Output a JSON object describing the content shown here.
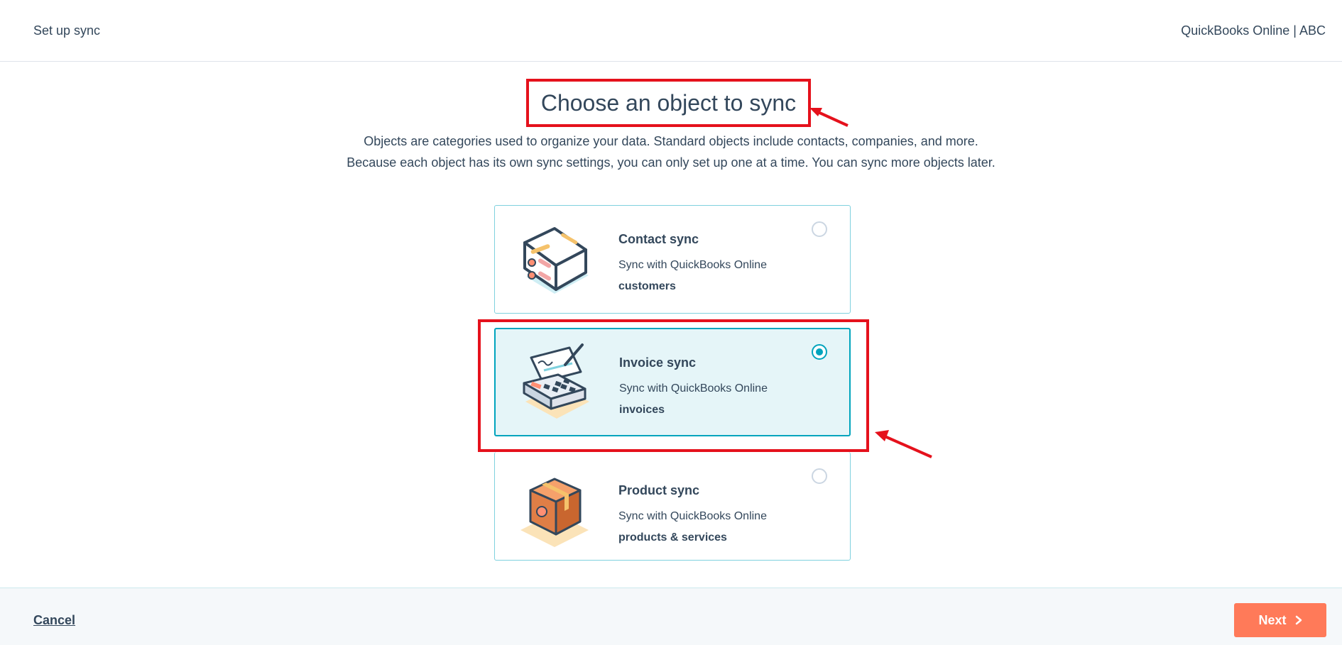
{
  "header": {
    "left_label": "Set up sync",
    "right_label": "QuickBooks Online | ABC"
  },
  "main": {
    "title": "Choose an object to sync",
    "description_line1": "Objects are categories used to organize your data. Standard objects include contacts, companies, and more.",
    "description_line2": "Because each object has its own sync settings, you can only set up one at a time. You can sync more objects later."
  },
  "options": [
    {
      "title": "Contact sync",
      "subtitle": "Sync with QuickBooks Online",
      "object": "customers",
      "icon": "contact-card-icon",
      "selected": false
    },
    {
      "title": "Invoice sync",
      "subtitle": "Sync with QuickBooks Online",
      "object": "invoices",
      "icon": "invoice-calculator-icon",
      "selected": true
    },
    {
      "title": "Product sync",
      "subtitle": "Sync with QuickBooks Online",
      "object": "products & services",
      "icon": "product-box-icon",
      "selected": false
    }
  ],
  "footer": {
    "cancel_label": "Cancel",
    "next_label": "Next"
  },
  "colors": {
    "accent": "#00a4bd",
    "selected_bg": "#e5f5f8",
    "primary_button": "#ff7a59",
    "annotation": "#e5111c",
    "text": "#33475b"
  }
}
